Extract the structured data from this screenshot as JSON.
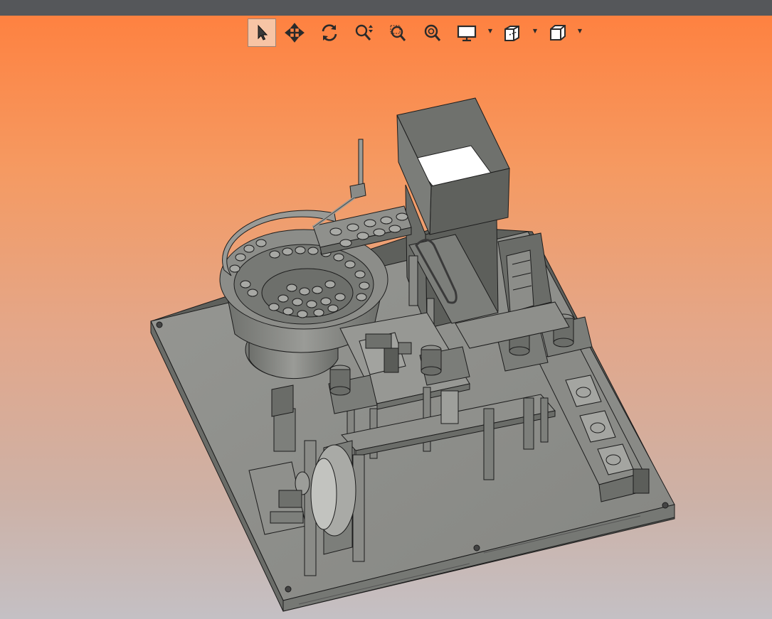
{
  "colors": {
    "titlebar": "#55575a",
    "background_top": "#ff7f3d",
    "background_bottom": "#c4c0c4",
    "model_gray": "#8d8e8a",
    "model_dark": "#5d5f5b",
    "edge": "#1c1c1c"
  },
  "toolbar": {
    "buttons": [
      {
        "id": "select",
        "icon": "arrow-cursor-icon",
        "active": true
      },
      {
        "id": "pan",
        "icon": "pan-arrows-icon"
      },
      {
        "id": "rotate",
        "icon": "rotate-icon"
      },
      {
        "id": "zoom-in-out",
        "icon": "zoom-updown-icon"
      },
      {
        "id": "zoom-window",
        "icon": "zoom-window-icon"
      },
      {
        "id": "zoom-fit",
        "icon": "zoom-fit-icon"
      },
      {
        "id": "display",
        "icon": "monitor-icon",
        "has_dropdown": true
      },
      {
        "id": "section",
        "icon": "section-view-icon",
        "has_dropdown": true
      },
      {
        "id": "view-orientation",
        "icon": "cube-view-icon",
        "has_dropdown": true
      }
    ]
  }
}
